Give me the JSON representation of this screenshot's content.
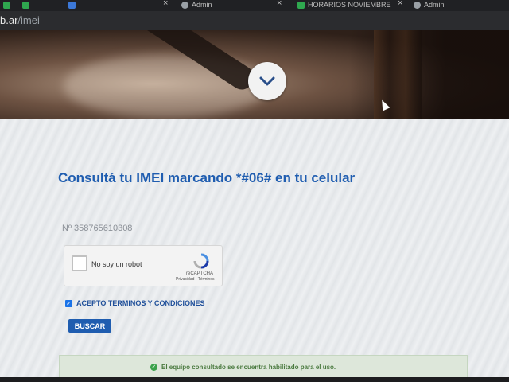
{
  "browser": {
    "tabs": [
      {
        "label": "",
        "color": "#2fa84f"
      },
      {
        "label": "",
        "color": "#2fa84f"
      },
      {
        "label": "",
        "color": "#3c78d8"
      },
      {
        "label": "Admin",
        "color": "#9aa0a6"
      },
      {
        "label": "HORARIOS NOVIEMBRE",
        "color": "#2fa84f"
      },
      {
        "label": "Admin",
        "color": "#9aa0a6"
      }
    ],
    "url_host": "b.ar",
    "url_path": "/imei"
  },
  "hero": {
    "scroll_icon": "chevron-down-icon"
  },
  "form": {
    "heading": "Consultá tu IMEI marcando *#06# en tu celular",
    "imei_value": "Nº 358765610308",
    "recaptcha_label": "No soy un robot",
    "recaptcha_brand": "reCAPTCHA",
    "recaptcha_terms": "Privacidad - Términos",
    "terms_label": "ACEPTO TERMINOS Y CONDICIONES",
    "terms_checked": true,
    "search_button": "BUSCAR"
  },
  "result": {
    "message": "El equipo consultado se encuentra habilitado para el uso.",
    "status_color": "#3aa14b"
  }
}
